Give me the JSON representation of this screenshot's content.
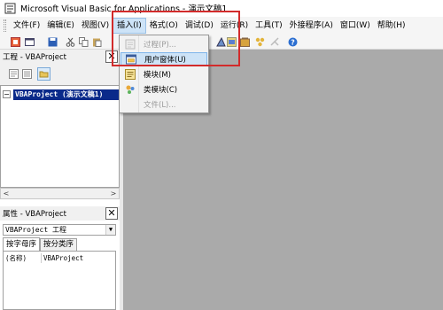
{
  "window": {
    "title": "Microsoft Visual Basic for Applications - 演示文稿1"
  },
  "menubar": {
    "items": [
      "文件(F)",
      "编辑(E)",
      "视图(V)",
      "插入(I)",
      "格式(O)",
      "调试(D)",
      "运行(R)",
      "工具(T)",
      "外接程序(A)",
      "窗口(W)",
      "帮助(H)"
    ]
  },
  "insert_menu": {
    "items": [
      {
        "label": "过程(P)...",
        "icon": "procedure-icon",
        "state": "disabled"
      },
      {
        "label": "用户窗体(U)",
        "icon": "userform-icon",
        "state": "selected"
      },
      {
        "label": "模块(M)",
        "icon": "module-icon",
        "state": "enabled"
      },
      {
        "label": "类模块(C)",
        "icon": "class-module-icon",
        "state": "enabled"
      },
      {
        "label": "文件(L)...",
        "icon": "",
        "state": "disabled"
      }
    ]
  },
  "project_pane": {
    "title": "工程 - VBAProject",
    "tree_root": "VBAProject (演示文稿1)"
  },
  "properties_pane": {
    "title": "属性 - VBAProject",
    "object_selector": "VBAProject 工程",
    "tabs": [
      "按字母序",
      "按分类序"
    ],
    "rows": [
      {
        "name": "(名称)",
        "value": "VBAProject"
      }
    ]
  },
  "colors": {
    "highlight_border": "#d22b2b",
    "workspace": "#aaaaaa",
    "tree_selection": "#0a2a8a",
    "menu_selected": "#cde3f7"
  }
}
